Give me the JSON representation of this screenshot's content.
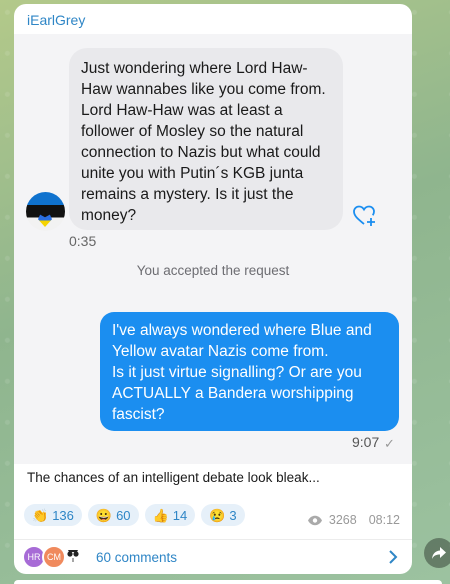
{
  "post": {
    "sender": "iEarlGrey",
    "screenshot": {
      "incoming_message": "Just wondering where Lord Haw-Haw wannabes like you come from. Lord Haw-Haw was at least a follower of Mosley so the natural connection to Nazis but what could unite you with Putin´s KGB junta remains a mystery. Is it just the money?",
      "incoming_time": "0:35",
      "system_note": "You accepted the request",
      "outgoing_message": "I've always wondered where Blue and Yellow avatar Nazis come from.\nIs it just virtue signalling? Or are you ACTUALLY a Bandera worshipping fascist?",
      "outgoing_time": "9:07",
      "outgoing_status_icon": "check-icon"
    },
    "caption": "The chances of an intelligent debate look bleak...",
    "reactions": [
      {
        "emoji": "👏",
        "count": "136"
      },
      {
        "emoji": "😀",
        "count": "60"
      },
      {
        "emoji": "👍",
        "count": "14"
      },
      {
        "emoji": "😢",
        "count": "3"
      }
    ],
    "views": "3268",
    "time": "08:12",
    "comments": {
      "avatars": [
        {
          "initials": "HR",
          "color": "#a76bd6"
        },
        {
          "initials": "CM",
          "color": "#f08a5d"
        }
      ],
      "label": "60 comments"
    }
  },
  "colors": {
    "accent": "#2f86c6",
    "outgoing_bubble": "#1b8ef0",
    "incoming_bubble": "#e9e9ec"
  }
}
